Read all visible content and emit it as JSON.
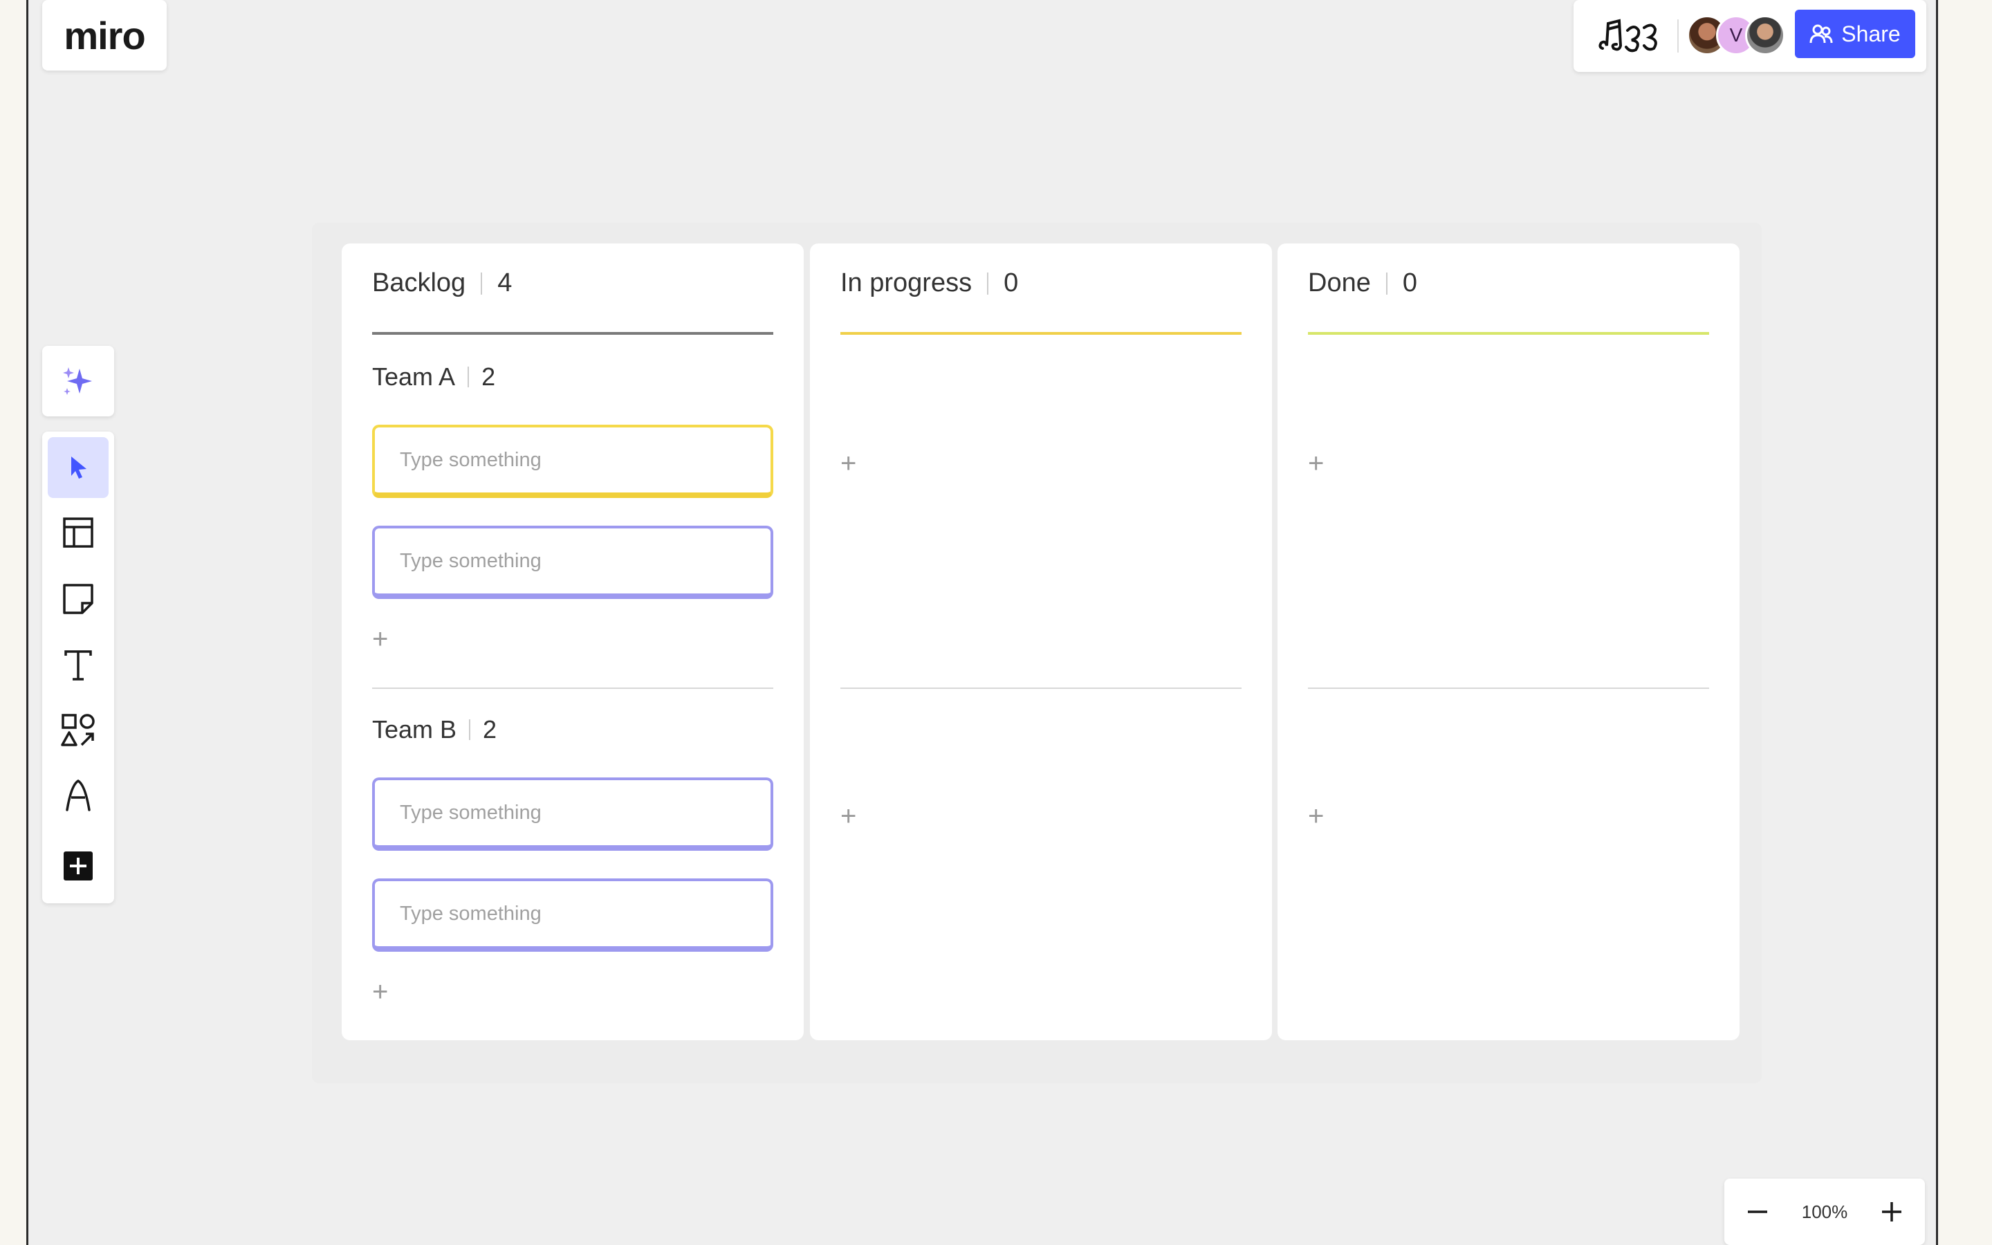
{
  "app": {
    "logo_text": "miro"
  },
  "header": {
    "collab_icon": "drawing-collab-icon",
    "avatars": [
      {
        "name": "avatar-user-1",
        "initial": ""
      },
      {
        "name": "avatar-user-v",
        "initial": "V"
      },
      {
        "name": "avatar-user-3",
        "initial": ""
      }
    ],
    "share_label": "Share"
  },
  "toolbar": {
    "ai_icon": "sparkles-icon",
    "tools": [
      "select-tool",
      "templates-tool",
      "sticky-note-tool",
      "text-tool",
      "shapes-tool",
      "pen-tool",
      "more-tools"
    ]
  },
  "board": {
    "columns": [
      {
        "title": "Backlog",
        "count": "4",
        "accent": "#7a7a7a"
      },
      {
        "title": "In progress",
        "count": "0",
        "accent": "#f0d04a"
      },
      {
        "title": "Done",
        "count": "0",
        "accent": "#d7e66a"
      }
    ],
    "teams": [
      {
        "name": "Team A",
        "count": "2",
        "cards": [
          {
            "placeholder": "Type something",
            "color": "yellow"
          },
          {
            "placeholder": "Type something",
            "color": "purple"
          }
        ]
      },
      {
        "name": "Team B",
        "count": "2",
        "cards": [
          {
            "placeholder": "Type something",
            "color": "purple"
          },
          {
            "placeholder": "Type something",
            "color": "purple"
          }
        ]
      }
    ]
  },
  "zoom": {
    "minus_icon": "zoom-out-icon",
    "value": "100%",
    "plus_icon": "zoom-in-icon"
  }
}
